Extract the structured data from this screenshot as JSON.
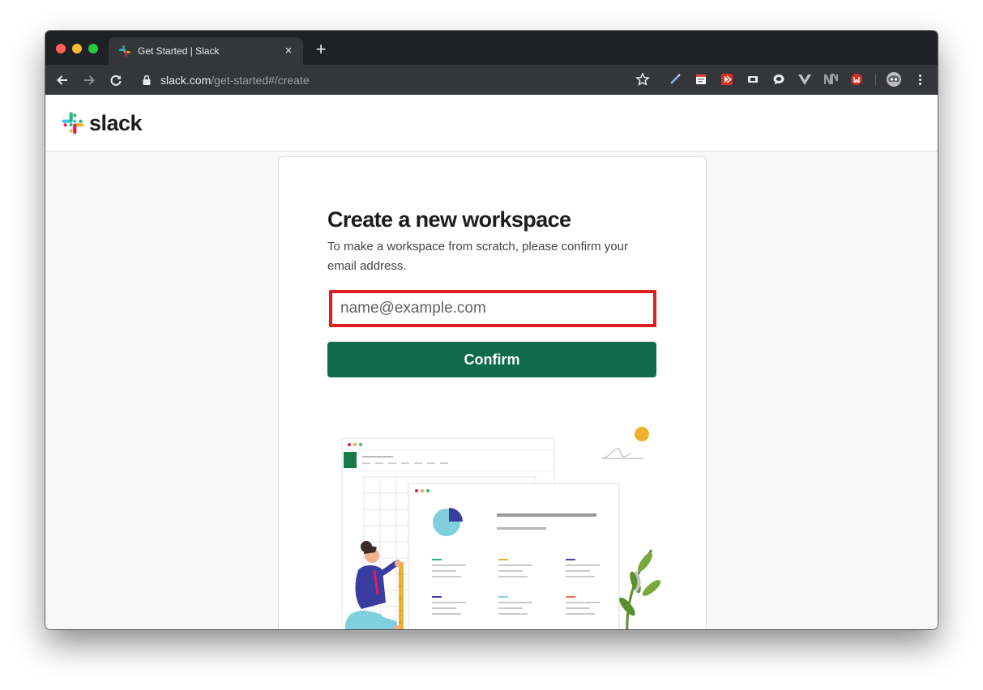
{
  "browser": {
    "tab": {
      "title": "Get Started | Slack",
      "close_glyph": "×"
    },
    "new_tab_glyph": "+",
    "url": {
      "host": "slack.com",
      "path": "/get-started#/create"
    },
    "extension_icons": [
      "pen-extension-icon",
      "notes-extension-icon",
      "red-play-extension-icon",
      "screen-extension-icon",
      "chat-bubble-extension-icon",
      "vue-devtools-icon",
      "mn-extension-icon",
      "red-shield-extension-icon",
      "profile-avatar-icon"
    ]
  },
  "site": {
    "logo_text": "slack",
    "brand_colors": {
      "green": "#2eb67d",
      "blue": "#36c5f0",
      "red": "#e01e5a",
      "yellow": "#ecb22e"
    }
  },
  "form": {
    "title": "Create a new workspace",
    "description": "To make a workspace from scratch, please confirm your email address.",
    "email_placeholder": "name@example.com",
    "email_value": "",
    "confirm_label": "Confirm",
    "confirm_color": "#106b4d",
    "highlight_color": "#e01e1e"
  }
}
